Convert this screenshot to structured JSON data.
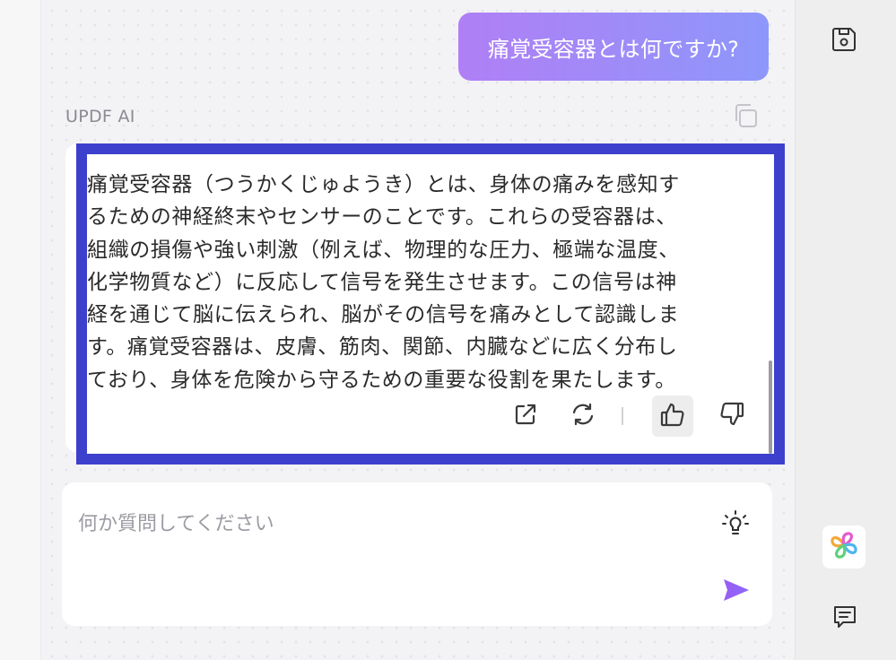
{
  "conversation": {
    "user_message": "痛覚受容器とは何ですか?",
    "assistant_label": "UPDF AI",
    "answer_lines": [
      "痛覚受容器（つうかくじゅようき）とは、身体の痛みを感知す",
      "るための神経終末やセンサーのことです。これらの受容器は、",
      "組織の損傷や強い刺激（例えば、物理的な圧力、極端な温度、",
      "化学物質など）に反応して信号を発生させます。この信号は神",
      "経を通じて脳に伝えられ、脳がその信号を痛みとして認識しま",
      "す。痛覚受容器は、皮膚、筋肉、関節、内臓などに広く分布し",
      "ており、身体を危険から守るための重要な役割を果たします。"
    ]
  },
  "answer_actions": [
    {
      "icon": "share-icon"
    },
    {
      "icon": "regenerate-icon"
    },
    {
      "icon": "thumbs-up-icon",
      "active": true
    },
    {
      "icon": "thumbs-down-icon"
    }
  ],
  "composer": {
    "placeholder": "何か質問してください",
    "value": ""
  },
  "icons": {
    "copy": "copy-icon",
    "save": "save-icon",
    "prompt_ideas": "lightbulb-icon",
    "send": "send-icon",
    "app_logo": "updf-logo-icon",
    "comment": "comment-icon"
  },
  "colors": {
    "highlight_border": "#3d40cc",
    "bubble_gradient_start": "#b07ff5",
    "bubble_gradient_end": "#8e97fb",
    "send_accent": "#9b59f5"
  }
}
